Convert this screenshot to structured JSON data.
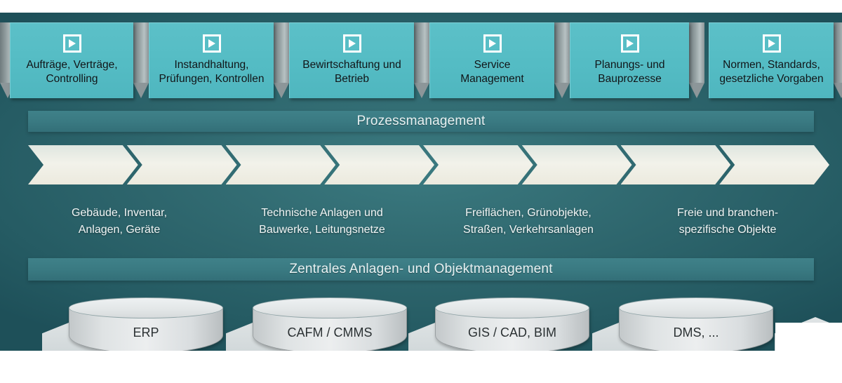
{
  "diagram": {
    "title": "Zentrales Anlagen- und Objektmanagement Prozessdiagramm",
    "colors": {
      "backdrop_teal": "#2e666d",
      "box_teal": "#54bcc4",
      "band_teal": "#3a7a82",
      "chevron_cream": "#efeee4",
      "cylinder_gray": "#dfe3e4",
      "connector_gray": "#94a0a2"
    }
  },
  "top_row": {
    "icon": "play-icon",
    "boxes": [
      {
        "label": "Aufträge, Verträge,\nControlling"
      },
      {
        "label": "Instandhaltung,\nPrüfungen, Kontrollen"
      },
      {
        "label": "Bewirtschaftung und\nBetrieb"
      },
      {
        "label": "Service\nManagement"
      },
      {
        "label": "Planungs- und\nBauprozesse"
      },
      {
        "label": "Normen, Standards,\ngesetzliche Vorgaben"
      }
    ]
  },
  "bands": {
    "process": "Prozessmanagement",
    "central": "Zentrales Anlagen- und Objektmanagement"
  },
  "chevrons": {
    "count": 8
  },
  "categories": [
    {
      "label": "Gebäude, Inventar,\nAnlagen, Geräte"
    },
    {
      "label": "Technische Anlagen und\nBauwerke, Leitungsnetze"
    },
    {
      "label": "Freiflächen, Grünobjekte,\nStraßen, Verkehrsanlagen"
    },
    {
      "label": "Freie  und  branchen-\nspezifische Objekte"
    }
  ],
  "databases": [
    {
      "label": "ERP"
    },
    {
      "label": "CAFM / CMMS"
    },
    {
      "label": "GIS / CAD, BIM"
    },
    {
      "label": "DMS, ..."
    }
  ]
}
